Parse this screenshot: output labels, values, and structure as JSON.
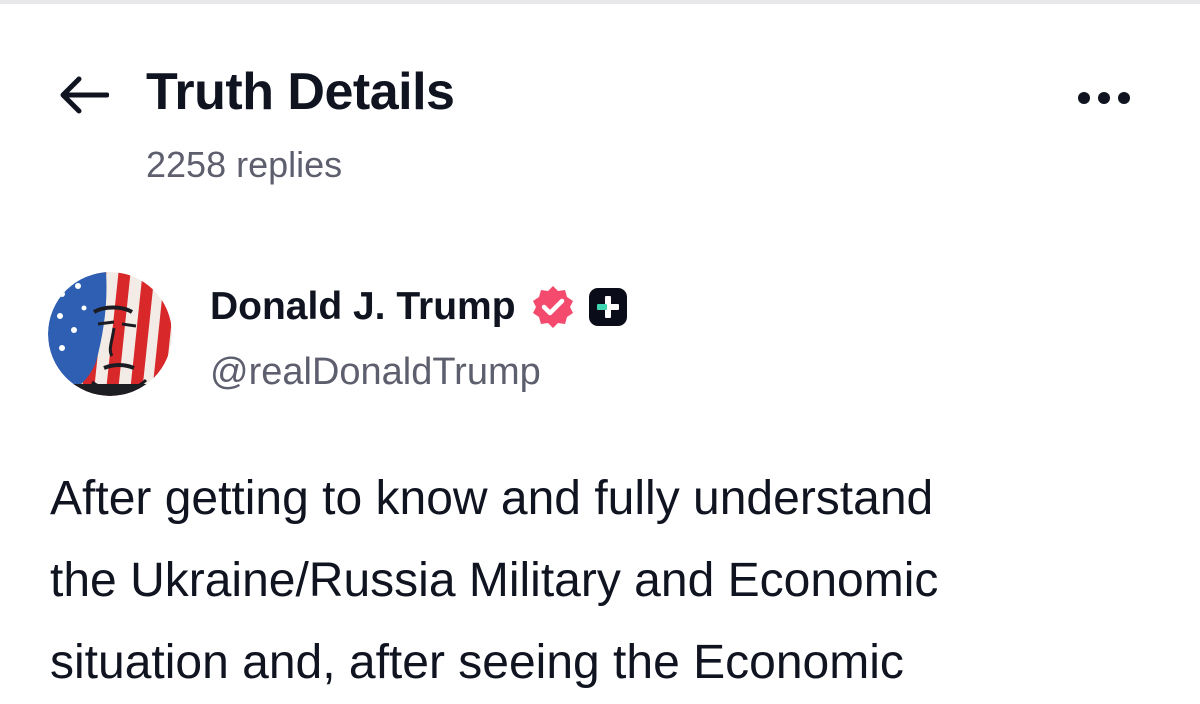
{
  "header": {
    "title": "Truth Details",
    "reply_count": "2258 replies",
    "back_icon": "arrow-left-icon",
    "more_icon": "more-horizontal-icon"
  },
  "author": {
    "display_name": "Donald J. Trump",
    "handle": "@realDonaldTrump",
    "avatar_icon": "flag-portrait-avatar",
    "verified_icon": "verified-badge-icon",
    "verified_color": "#f44a6d",
    "plus_icon": "plus-badge-icon",
    "plus_color": "#0b0c1a",
    "plus_accent": "#3fd4b0"
  },
  "post": {
    "lines": [
      "After getting to know and fully understand",
      "the Ukraine/Russia Military and Economic",
      "situation and, after seeing the Economic"
    ]
  },
  "colors": {
    "text_primary": "#101421",
    "text_secondary": "#5e5f6e",
    "background": "#ffffff"
  }
}
